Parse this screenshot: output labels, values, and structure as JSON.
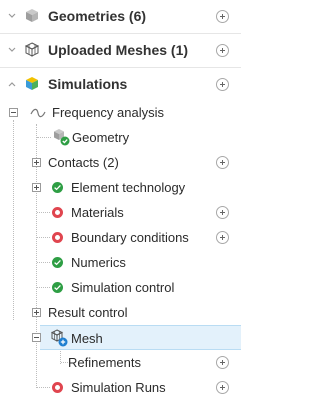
{
  "sections": [
    {
      "title": "Geometries (6)",
      "icon": "geometries-icon"
    },
    {
      "title": "Uploaded Meshes (1)",
      "icon": "meshes-icon"
    },
    {
      "title": "Simulations",
      "icon": "simulations-icon"
    }
  ],
  "tree": {
    "analysis": {
      "label": "Frequency analysis",
      "icon": "wave-icon"
    },
    "geometry": {
      "label": "Geometry"
    },
    "contacts": {
      "label": "Contacts (2)"
    },
    "element_technology": {
      "label": "Element technology",
      "status": "ok"
    },
    "materials": {
      "label": "Materials",
      "status": "error"
    },
    "boundary_conditions": {
      "label": "Boundary conditions",
      "status": "error"
    },
    "numerics": {
      "label": "Numerics",
      "status": "ok"
    },
    "simulation_control": {
      "label": "Simulation control",
      "status": "ok"
    },
    "result_control": {
      "label": "Result control"
    },
    "mesh": {
      "label": "Mesh",
      "selected": true
    },
    "refinements": {
      "label": "Refinements"
    },
    "simulation_runs": {
      "label": "Simulation Runs",
      "status": "error"
    }
  },
  "colors": {
    "ok": "#2e9e44",
    "error": "#e0454f",
    "selected_bg": "#e3f1fb"
  }
}
